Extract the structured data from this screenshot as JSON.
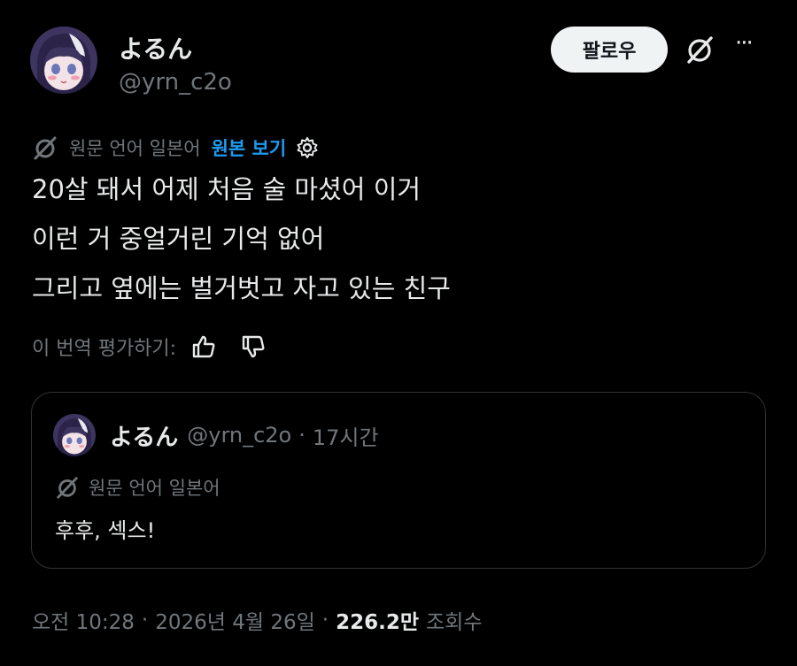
{
  "author": {
    "display_name": "よるん",
    "handle": "@yrn_c2o"
  },
  "header": {
    "follow_label": "팔로우",
    "more_glyph": "···"
  },
  "translation": {
    "source_language": "원문 언어 일본어",
    "show_original": "원본 보기"
  },
  "tweet": {
    "lines": [
      "20살 돼서 어제 처음 술 마셨어 이거",
      "이런 거 중얼거린 기억 없어",
      "그리고 옆에는 벌거벗고 자고 있는 친구"
    ]
  },
  "rating": {
    "label": "이 번역 평가하기:"
  },
  "quote": {
    "display_name": "よるん",
    "handle": "@yrn_c2o",
    "separator": "·",
    "time": "17시간",
    "source_language": "원문 언어 일본어",
    "text": "후후, 섹스!"
  },
  "meta": {
    "time": "오전 10:28",
    "separator1": "·",
    "date": "2026년 4월 26일",
    "separator2": "·",
    "views_count": "226.2만",
    "views_label": "조회수"
  },
  "colors": {
    "background": "#000000",
    "text": "#e7e9ea",
    "muted": "#71767b",
    "link": "#1d9bf0",
    "border": "#2f3336"
  }
}
